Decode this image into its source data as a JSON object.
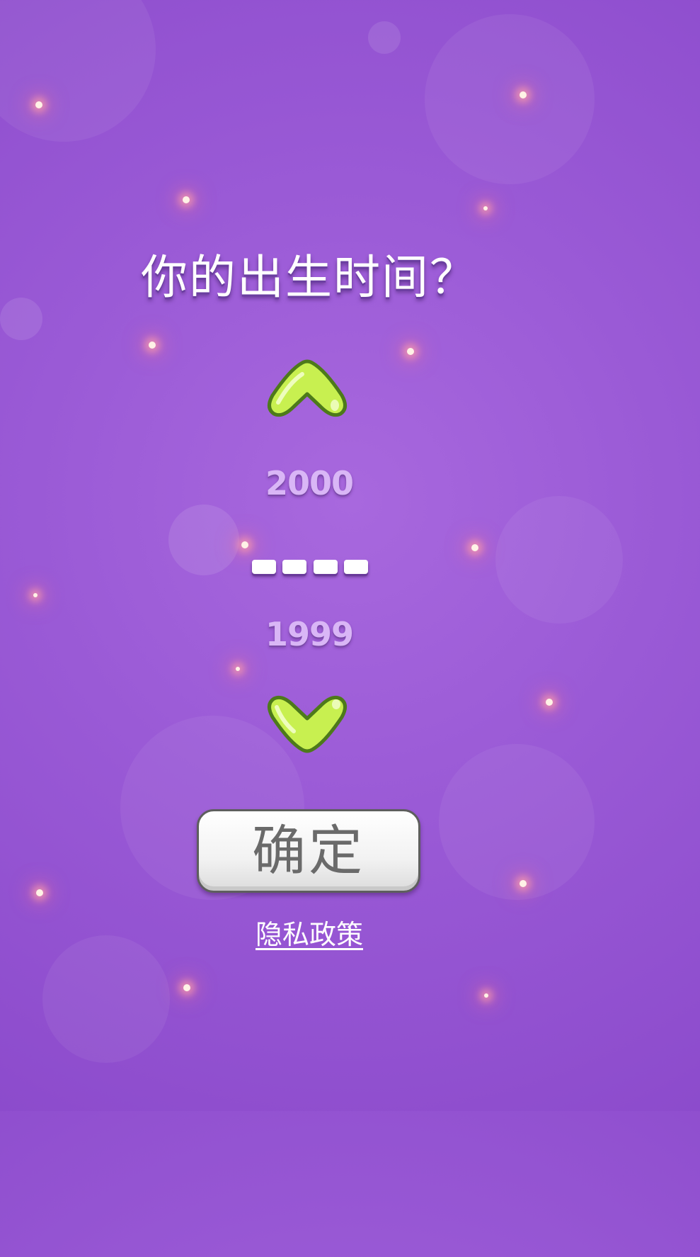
{
  "screen": {
    "title": "你的出生时间？",
    "icons": {
      "up": "chevron-up-icon",
      "down": "chevron-down-icon"
    },
    "year_picker": {
      "next_year": "2000",
      "selected_placeholder": "----",
      "previous_year": "1999"
    },
    "confirm_label": "确定",
    "privacy_label": "隐私政策"
  },
  "colors": {
    "background": "#9a5ad6",
    "arrow_fill": "#c8f050",
    "arrow_outline": "#4d7a1a",
    "year_text": "#d9b6f6",
    "button_text": "#6a6a6a"
  }
}
